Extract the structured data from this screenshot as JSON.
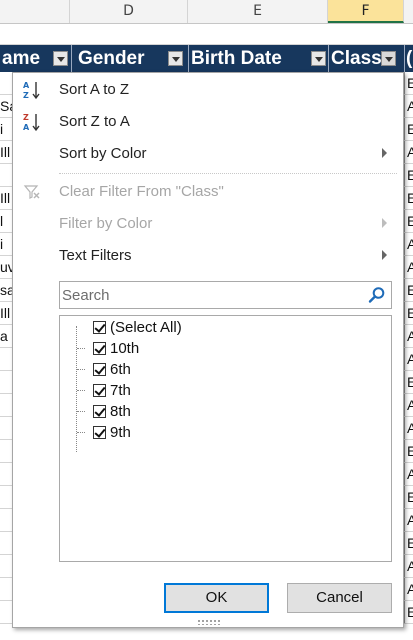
{
  "columns": [
    "D",
    "E",
    "F"
  ],
  "headers": {
    "name_partial": "ame",
    "gender": "Gender",
    "birth_date": "Birth Date",
    "class": "Class",
    "next_partial": "("
  },
  "left_cells": [
    "",
    "Sa",
    "i",
    "Ill",
    "",
    "Ill",
    "l",
    "i",
    "uv",
    "sa",
    "Ill",
    "a",
    "",
    "",
    "",
    "",
    "",
    "",
    "",
    "",
    "",
    "",
    "",
    ""
  ],
  "right_cells": [
    "E",
    "A",
    "E",
    "A",
    "E",
    "E",
    "E",
    "A",
    "A",
    "E",
    "E",
    "A",
    "A",
    "E",
    "A",
    "A",
    "E",
    "A",
    "E",
    "A",
    "E",
    "A",
    "A",
    "E"
  ],
  "menu": {
    "sort_az": "Sort A to Z",
    "sort_za": "Sort Z to A",
    "sort_by_color": "Sort by Color",
    "clear_filter": "Clear Filter From \"Class\"",
    "filter_by_color": "Filter by Color",
    "text_filters": "Text Filters"
  },
  "search": {
    "placeholder": "Search",
    "value": ""
  },
  "filter_items": [
    {
      "label": "(Select All)",
      "checked": true
    },
    {
      "label": "10th",
      "checked": true
    },
    {
      "label": "6th",
      "checked": true
    },
    {
      "label": "7th",
      "checked": true
    },
    {
      "label": "8th",
      "checked": true
    },
    {
      "label": "9th",
      "checked": true
    }
  ],
  "buttons": {
    "ok": "OK",
    "cancel": "Cancel"
  },
  "colors": {
    "header_fill": "#17375d",
    "selected_column": "#fbe39a",
    "ok_border": "#0078d7",
    "search_icon": "#1e6bb8"
  },
  "icons": [
    "sort-az-icon",
    "sort-za-icon",
    "clear-filter-icon",
    "search-icon",
    "dropdown-arrow-icon",
    "chevron-right-icon",
    "checkbox-checked-icon",
    "resize-grip-icon"
  ]
}
